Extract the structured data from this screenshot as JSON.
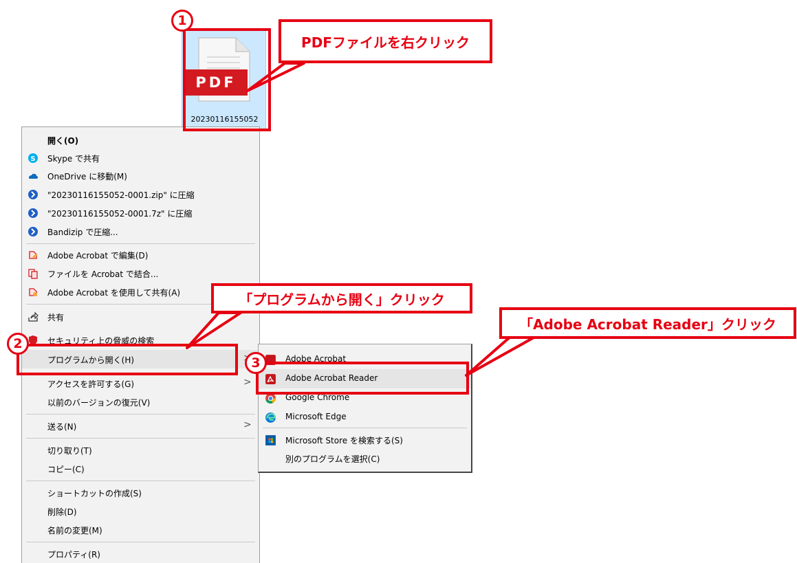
{
  "file": {
    "name": "20230116155052",
    "badge": "PDF"
  },
  "menu": {
    "items": [
      {
        "label": "開く(O)",
        "icon": "none"
      },
      {
        "label": "Skype で共有",
        "icon": "skype-icon"
      },
      {
        "label": "OneDrive に移動(M)",
        "icon": "onedrive-icon"
      },
      {
        "label": "\"20230116155052-0001.zip\" に圧縮",
        "icon": "bandizip-icon"
      },
      {
        "label": "\"20230116155052-0001.7z\" に圧縮",
        "icon": "bandizip-icon"
      },
      {
        "label": "Bandizip で圧縮...",
        "icon": "bandizip-icon"
      },
      {
        "label": "Adobe Acrobat で編集(D)",
        "icon": "acrobat-edit-icon"
      },
      {
        "label": "ファイルを Acrobat で結合...",
        "icon": "acrobat-combine-icon"
      },
      {
        "label": "Adobe Acrobat を使用して共有(A)",
        "icon": "acrobat-share-icon"
      },
      {
        "label": "共有",
        "icon": "share-icon"
      },
      {
        "label": "セキュリティ上の脅威の検索",
        "icon": "defender-icon"
      },
      {
        "label": "プログラムから開く(H)",
        "icon": "none"
      },
      {
        "label": "アクセスを許可する(G)",
        "icon": "none"
      },
      {
        "label": "以前のバージョンの復元(V)",
        "icon": "none"
      },
      {
        "label": "送る(N)",
        "icon": "none"
      },
      {
        "label": "切り取り(T)",
        "icon": "none"
      },
      {
        "label": "コピー(C)",
        "icon": "none"
      },
      {
        "label": "ショートカットの作成(S)",
        "icon": "none"
      },
      {
        "label": "削除(D)",
        "icon": "none"
      },
      {
        "label": "名前の変更(M)",
        "icon": "none"
      },
      {
        "label": "プロパティ(R)",
        "icon": "none"
      }
    ],
    "submenu_arrow": ">"
  },
  "submenu": {
    "items": [
      {
        "label": "Adobe Acrobat",
        "icon": "acrobat-icon"
      },
      {
        "label": "Adobe Acrobat Reader",
        "icon": "acrobat-reader-icon"
      },
      {
        "label": "Google Chrome",
        "icon": "chrome-icon"
      },
      {
        "label": "Microsoft Edge",
        "icon": "edge-icon"
      },
      {
        "label": "Microsoft Store を検索する(S)",
        "icon": "store-icon"
      },
      {
        "label": "別のプログラムを選択(C)",
        "icon": "none"
      }
    ]
  },
  "annotations": {
    "step1_num": "1",
    "step1_text": "PDFファイルを右クリック",
    "step2_num": "2",
    "step2_text": "「プログラムから開く」クリック",
    "step3_num": "3",
    "step3_text": "「Adobe Acrobat Reader」クリック"
  },
  "colors": {
    "accent": "#e60012",
    "pdf_red": "#d41a21",
    "menu_bg": "#f2f2f2",
    "selection": "#cce8ff"
  }
}
